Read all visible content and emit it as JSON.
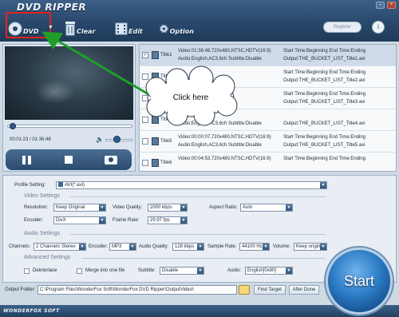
{
  "app": {
    "title": "DVD RIPPER",
    "brand_footer": "WONDERFOX SOFT"
  },
  "window": {
    "minimize": "–",
    "close": "×"
  },
  "toolbar": {
    "dvd_label": "DVD",
    "clear_label": "Clear",
    "edit_label": "Edit",
    "option_label": "Option",
    "register_label": "Register",
    "info_label": "i"
  },
  "player": {
    "time": "00:01:23 / 01:36:48"
  },
  "titles": [
    {
      "name": "Title1",
      "checked": true,
      "selected": true,
      "info1": "Video:01:36:48,720x480,NTSC,HDTV(16:9)",
      "info2": "Audio:English,AC3,6ch Subtitle:Disable",
      "right1": "Start Time:Beginning End Time:Ending",
      "right2": "Output:THE_BUCKET_LIST_Title1.avi"
    },
    {
      "name": "Title2",
      "checked": false,
      "selected": false,
      "info1": "",
      "info2": "",
      "right1": "Start Time:Beginning End Time:Ending",
      "right2": "Output:THE_BUCKET_LIST_Title2.avi"
    },
    {
      "name": "Title3",
      "checked": false,
      "selected": false,
      "info1": "",
      "info2": "",
      "right1": "Start Time:Beginning End Time:Ending",
      "right2": "Output:THE_BUCKET_LIST_Title3.avi"
    },
    {
      "name": "Title4",
      "checked": false,
      "selected": false,
      "info1": "",
      "info2": "Audio:English,AC3,6ch Subtitle:Disable",
      "right1": "",
      "right2": "Output:THE_BUCKET_LIST_Title4.avi"
    },
    {
      "name": "Title5",
      "checked": false,
      "selected": false,
      "info1": "Video:00:00:07,720x480,NTSC,HDTV(16:9)",
      "info2": "Audio:English,AC3,6ch Subtitle:Disable",
      "right1": "Start Time:Beginning End Time:Ending",
      "right2": "Output:THE_BUCKET_LIST_Title5.avi"
    },
    {
      "name": "Title6",
      "checked": false,
      "selected": false,
      "info1": "Video:00:04:53,720x480,NTSC,HDTV(16:9)",
      "info2": "",
      "right1": "Start Time:Beginning End Time:Ending",
      "right2": ""
    }
  ],
  "callout": {
    "text": "Click here"
  },
  "settings": {
    "profile_label": "Profile Setting:",
    "profile_value": "AVI(*.avi)",
    "video_header": "Video Settings",
    "resolution_label": "Resolution:",
    "resolution_value": "Keep Original",
    "video_quality_label": "Video Quality:",
    "video_quality_value": "2000 kbps",
    "aspect_label": "Aspect Ratio:",
    "aspect_value": "Auto",
    "encoder_label": "Encoder:",
    "encoder_value": "DivX",
    "frame_rate_label": "Frame Rate:",
    "frame_rate_value": "29.97 fps",
    "audio_header": "Audio Settings",
    "channels_label": "Channels:",
    "channels_value": "2 Channels Stereo",
    "audio_encoder_label": "Encoder:",
    "audio_encoder_value": "MP3",
    "audio_quality_label": "Audio Quality:",
    "audio_quality_value": "128 kbps",
    "sample_rate_label": "Sample Rate:",
    "sample_rate_value": "44100 Hz",
    "volume_label": "Volume:",
    "volume_value": "Keep origina",
    "advanced_header": "Advanced Settings",
    "deinterlace_label": "Deinterlace",
    "merge_label": "Merge into one file",
    "subtitle_label": "Subtitle:",
    "subtitle_value": "Disable",
    "audio_track_label": "Audio:",
    "audio_track_value": "English[0x80]"
  },
  "output": {
    "label": "Output Folder:",
    "path": "C:\\Program Files\\WonderFox Soft\\WonderFox DVD Ripper\\OutputVideo\\",
    "find_target": "Find Target",
    "after_done": "After Done"
  },
  "start": {
    "label": "Start"
  },
  "colors": {
    "highlight_box": "#e0241c",
    "arrow": "#1f9e2a",
    "accent": "#2d7cc5"
  }
}
